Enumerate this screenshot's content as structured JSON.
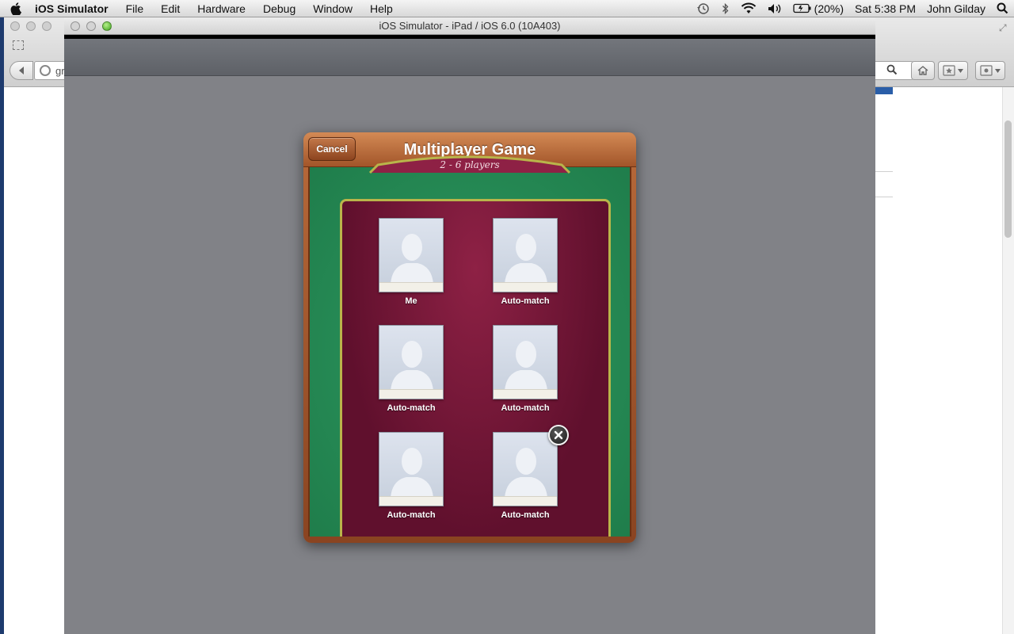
{
  "menubar": {
    "app_name": "iOS Simulator",
    "menus": [
      "File",
      "Edit",
      "Hardware",
      "Debug",
      "Window",
      "Help"
    ],
    "battery_percent": "(20%)",
    "clock": "Sat 5:38 PM",
    "user": "John Gilday",
    "icons": [
      "apple-icon",
      "time-machine-icon",
      "bluetooth-icon",
      "wifi-icon",
      "volume-icon",
      "battery-icon",
      "spotlight-icon"
    ]
  },
  "browser": {
    "address_partial": "gra"
  },
  "simulator": {
    "window_title": "iOS Simulator - iPad / iOS 6.0 (10A403)"
  },
  "game_center": {
    "cancel_label": "Cancel",
    "title": "Multiplayer Game",
    "players_range": "2 - 6 players",
    "slots": [
      {
        "label": "Me"
      },
      {
        "label": "Auto-match"
      },
      {
        "label": "Auto-match"
      },
      {
        "label": "Auto-match"
      },
      {
        "label": "Auto-match"
      },
      {
        "label": "Auto-match"
      }
    ],
    "colors": {
      "felt": "#1f7d4b",
      "table": "#60102d",
      "wood": "#a2552a",
      "trim": "#b9b54a"
    }
  }
}
